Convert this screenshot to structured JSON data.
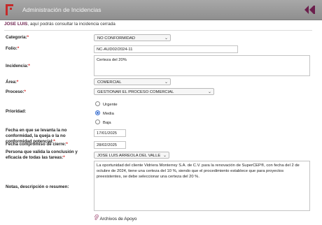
{
  "header": {
    "title": "Administración de Incidencias",
    "logo_icon": "red-flag-logo-icon",
    "back_icon": "double-chevron-left-icon"
  },
  "notice": {
    "user": "JOSE LUIS",
    "text": ", aquí podrás consultar la incidencia cerrada"
  },
  "form": {
    "categoria": {
      "label": "Categoria:",
      "value": "NO CONFORMIDAD"
    },
    "folio": {
      "label": "Folio:",
      "value": "NC-AUD02/2024-11"
    },
    "incidencia": {
      "label": "Incidencia:",
      "value": "Certeza del 20%"
    },
    "area": {
      "label": "Área:",
      "value": "COMERCIAL"
    },
    "proceso": {
      "label": "Proceso:",
      "value": "GESTIONAR EL PROCESO COMERCIAL"
    },
    "prioridad": {
      "label": "Prioridad:",
      "options": [
        "Urgente",
        "Media",
        "Baja"
      ],
      "selected": "Media"
    },
    "fecha_levanta": {
      "label": "Fecha en que se levanta la no conformidad, la queja o la no conformidad potencial:",
      "value": "17/01/2025"
    },
    "fecha_cierre": {
      "label": "Fecha compromiso de cierre:",
      "value": "28/02/2025"
    },
    "persona_valida": {
      "label": "Persona que valida la conclusión y eficacia de todas las tareas:",
      "value": "JOSE LUIS ARREOLA DEL VALLE"
    },
    "notas": {
      "label": "Notas, descripción o resumen:",
      "value": "La oportunidad del cliente Vidriera Monterrey S.A. de C.V. para la renovación de SuperCEP®, con fecha del 2 de octubre de 2024, tiene una certeza del 10 %, siendo que el procedimiento establece que para proyectos preexistentes, se debe seleccionar una certeza del 20 %."
    },
    "archivos": {
      "label": "Archivos de Apoyo",
      "icon": "paperclip-icon"
    }
  },
  "colors": {
    "accent": "#6b1e4c",
    "required": "#dd2222",
    "titlebar": "#9a9a9a",
    "logo": "#c42a2a"
  }
}
